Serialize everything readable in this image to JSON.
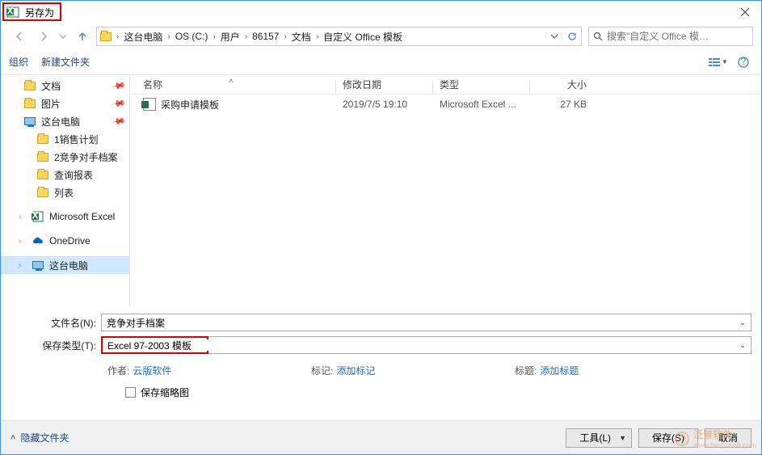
{
  "window": {
    "title": "另存为"
  },
  "breadcrumbs": [
    "这台电脑",
    "OS (C:)",
    "用户",
    "86157",
    "文档",
    "自定义 Office 模板"
  ],
  "search": {
    "placeholder": "搜索\"自定义 Office 模…"
  },
  "toolbar": {
    "organize": "组织",
    "newfolder": "新建文件夹"
  },
  "columns": {
    "name": "名称",
    "date": "修改日期",
    "type": "类型",
    "size": "大小"
  },
  "files": [
    {
      "name": "采购申请模板",
      "date": "2019/7/5 19:10",
      "type": "Microsoft Excel ...",
      "size": "27 KB"
    }
  ],
  "sidebar": {
    "items": [
      {
        "label": "文档",
        "icon": "folder",
        "pinned": true
      },
      {
        "label": "图片",
        "icon": "folder",
        "pinned": true
      },
      {
        "label": "这台电脑",
        "icon": "monitor",
        "pinned": true
      },
      {
        "label": "1销售计划",
        "icon": "folder"
      },
      {
        "label": "2竞争对手档案",
        "icon": "folder"
      },
      {
        "label": "查询报表",
        "icon": "folder"
      },
      {
        "label": "列表",
        "icon": "folder"
      }
    ],
    "roots": [
      {
        "label": "Microsoft Excel",
        "icon": "excel"
      },
      {
        "label": "OneDrive",
        "icon": "onedrive"
      },
      {
        "label": "这台电脑",
        "icon": "monitor",
        "selected": true
      }
    ]
  },
  "form": {
    "filename_label": "文件名(N):",
    "filetype_label": "保存类型(T):",
    "filename_value": "竞争对手档案",
    "filetype_value": "Excel 97-2003 模板",
    "author_label": "作者:",
    "author_value": "云版软件",
    "tags_label": "标记:",
    "tags_value": "添加标记",
    "title_label": "标题:",
    "title_value": "添加标题",
    "thumb_label": "保存缩略图"
  },
  "footer": {
    "hide": "隐藏文件夹",
    "tools": "工具(L)",
    "save": "保存(S)",
    "cancel": "取消"
  },
  "watermark": {
    "brand": "泛普软件",
    "url": "www.fanpusoft.com"
  }
}
